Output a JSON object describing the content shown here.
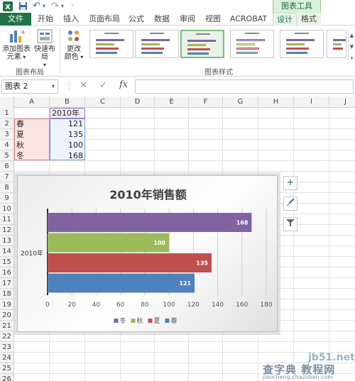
{
  "titlebar": {
    "save_icon": "save-icon",
    "undo_icon": "undo-icon",
    "redo_icon": "redo-icon",
    "context_tab": "图表工具"
  },
  "tabs": {
    "file": "文件",
    "items": [
      "开始",
      "插入",
      "页面布局",
      "公式",
      "数据",
      "审阅",
      "视图",
      "ACROBAT",
      "设计",
      "格式"
    ],
    "active": "设计"
  },
  "ribbon": {
    "add_chart_element": "添加图表\n元素",
    "add_chart_element_l1": "添加图表",
    "add_chart_element_l2": "元素",
    "quick_layout_l1": "快速布局",
    "change_colors_l1": "更改",
    "change_colors_l2": "颜色",
    "group_layout": "图表布局",
    "group_styles": "图表样式"
  },
  "formula_bar": {
    "name_box": "图表 2",
    "cancel": "✕",
    "enter": "✓",
    "fx": "fx",
    "content": ""
  },
  "grid": {
    "columns": [
      "A",
      "B",
      "C",
      "D",
      "E",
      "F",
      "G",
      "H",
      "I",
      "J"
    ],
    "rows": [
      "1",
      "2",
      "3",
      "4",
      "5",
      "6",
      "7",
      "8",
      "9",
      "10",
      "11",
      "12",
      "13",
      "14",
      "15",
      "16",
      "17",
      "18",
      "19",
      "20",
      "21",
      "22",
      "23",
      "24",
      "25",
      "26"
    ],
    "header_b1": "2010年",
    "data": [
      {
        "label": "春",
        "value": "121"
      },
      {
        "label": "夏",
        "value": "135"
      },
      {
        "label": "秋",
        "value": "100"
      },
      {
        "label": "冬",
        "value": "168"
      }
    ]
  },
  "chart_data": {
    "type": "bar",
    "orientation": "horizontal",
    "title": "2010年销售额",
    "category_label": "2010年",
    "series": [
      {
        "name": "冬",
        "value": 168,
        "color": "#8064a2"
      },
      {
        "name": "秋",
        "value": 100,
        "color": "#9bbb59"
      },
      {
        "name": "夏",
        "value": 135,
        "color": "#c0504d"
      },
      {
        "name": "春",
        "value": 121,
        "color": "#4f81bd"
      }
    ],
    "xlim": [
      0,
      180
    ],
    "xticks": [
      "0",
      "20",
      "40",
      "60",
      "80",
      "100",
      "120",
      "140",
      "160",
      "180"
    ],
    "grid": true,
    "legend_position": "bottom",
    "legend": [
      "冬",
      "秋",
      "夏",
      "春"
    ]
  },
  "chart_buttons": {
    "plus": "+",
    "brush_icon": "brush-icon",
    "filter_icon": "filter-icon"
  },
  "watermark": {
    "site": "jb51.net",
    "text": "查字典 教程网",
    "url": "jiaocheng.chazidian.com"
  }
}
